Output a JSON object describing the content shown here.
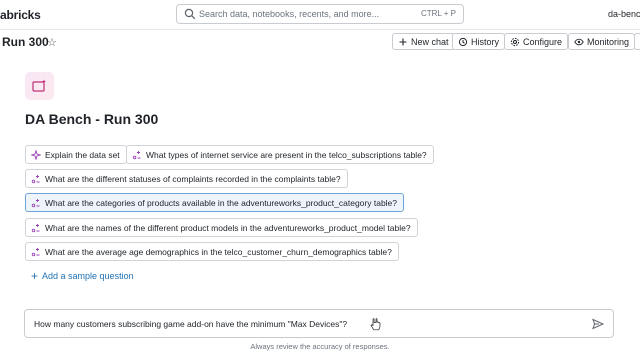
{
  "topbar": {
    "brand": "abricks",
    "search_placeholder": "Search data, notebooks, recents, and more...",
    "search_shortcut": "CTRL + P",
    "user": "da-benc"
  },
  "titlebar": {
    "title": "Run 300",
    "star": "☆",
    "buttons": {
      "new_chat": "New chat",
      "history": "History",
      "configure": "Configure",
      "monitoring": "Monitoring"
    }
  },
  "hero": {
    "title": "DA Bench - Run 300"
  },
  "suggestions": [
    {
      "label": "Explain the data set",
      "icon": "sparkle-icon"
    },
    {
      "label": "What types of internet service are present in the telco_subscriptions table?",
      "icon": "sample-question-icon"
    },
    {
      "label": "What are the different statuses of complaints recorded in the complaints table?",
      "icon": "sample-question-icon"
    },
    {
      "label": "What are the categories of products available in the adventureworks_product_category table?",
      "icon": "sample-question-icon"
    },
    {
      "label": "What are the names of the different product models in the adventureworks_product_model table?",
      "icon": "sample-question-icon"
    },
    {
      "label": "What are the average age demographics in the telco_customer_churn_demographics table?",
      "icon": "sample-question-icon"
    }
  ],
  "add_sample": {
    "icon": "+",
    "label": "Add a sample question"
  },
  "composer": {
    "value": "How many customers subscribing game add-on have the minimum \"Max Devices\"?"
  },
  "footnote": "Always review the accuracy of responses.",
  "colors": {
    "accent": "#2272b4",
    "selected_bg": "#eef4fb",
    "hero_gradient_start": "#f7e7f6",
    "hero_icon_stroke": "#c0307a"
  }
}
